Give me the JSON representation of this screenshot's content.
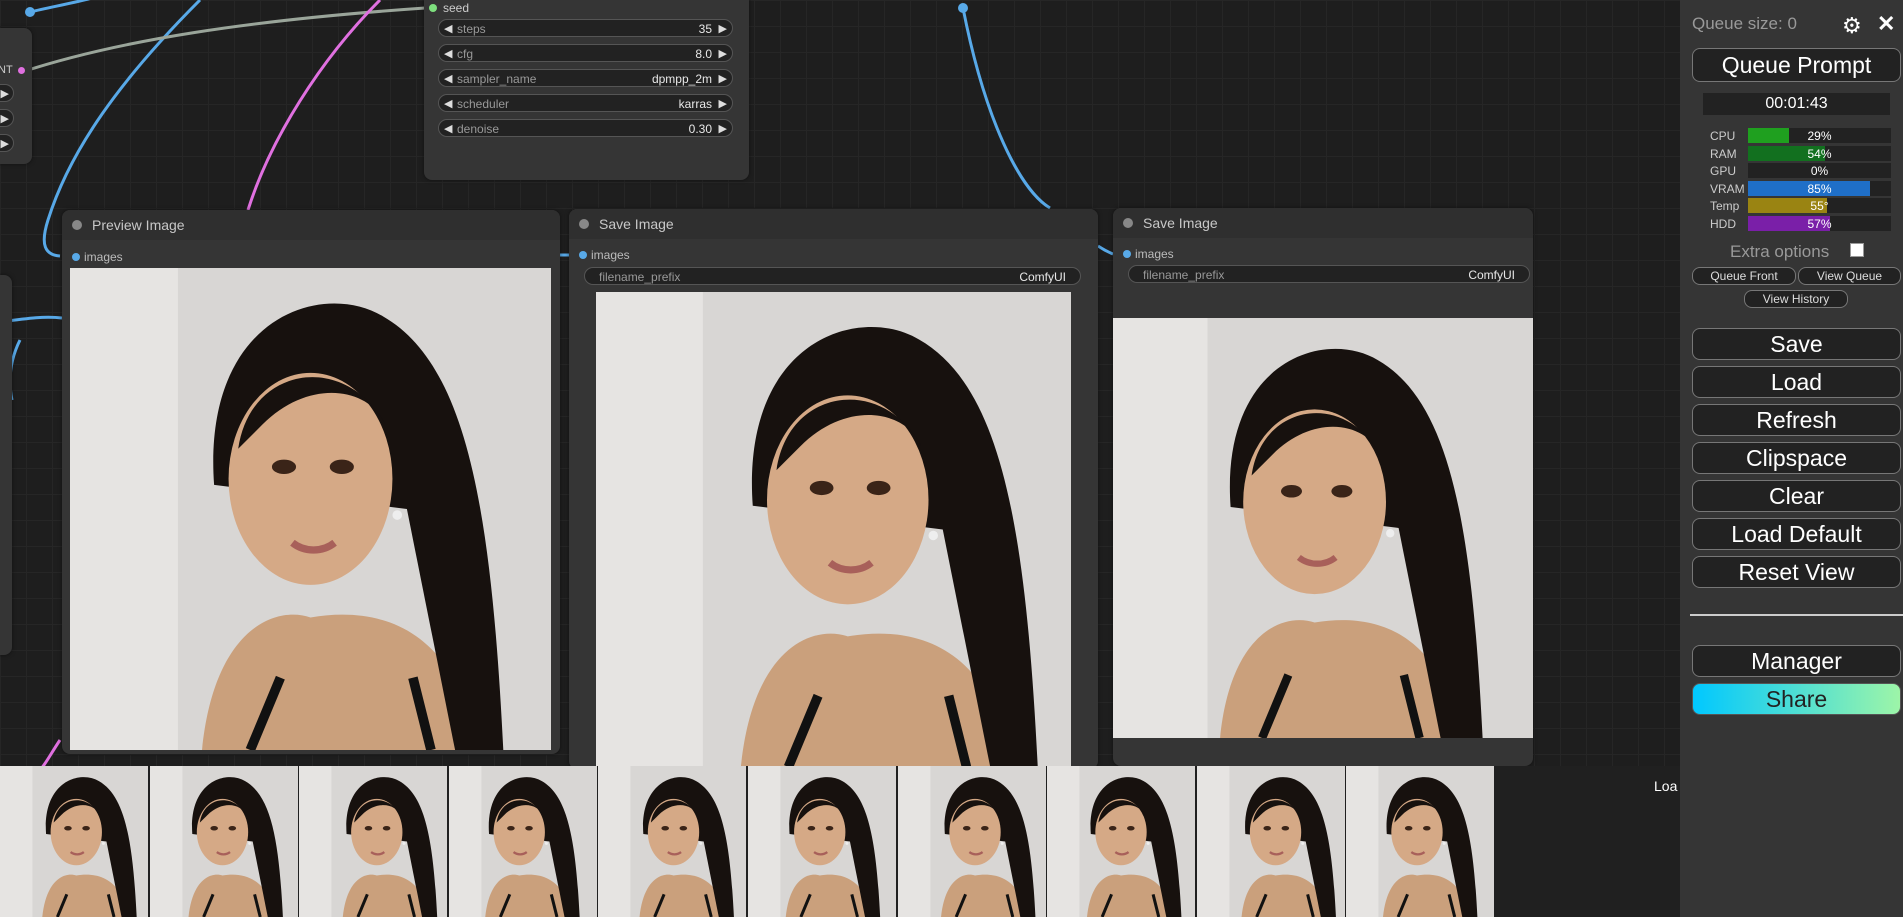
{
  "sampler_node": {
    "seed_label": "seed",
    "widgets": [
      {
        "label": "steps",
        "value": "35"
      },
      {
        "label": "cfg",
        "value": "8.0"
      },
      {
        "label": "sampler_name",
        "value": "dpmpp_2m"
      },
      {
        "label": "scheduler",
        "value": "karras"
      },
      {
        "label": "denoise",
        "value": "0.30"
      }
    ]
  },
  "left_node": {
    "output_label": "NT"
  },
  "preview_node": {
    "title": "Preview Image",
    "input_label": "images"
  },
  "save_node_1": {
    "title": "Save Image",
    "input_label": "images",
    "prefix_label": "filename_prefix",
    "prefix_value": "ComfyUI"
  },
  "save_node_2": {
    "title": "Save Image",
    "input_label": "images",
    "prefix_label": "filename_prefix",
    "prefix_value": "ComfyUI"
  },
  "strip": {
    "label": "Loa",
    "thumbnail_count": 10
  },
  "menu": {
    "queue_size": "Queue size: 0",
    "queue_prompt": "Queue Prompt",
    "timer": "00:01:43",
    "stats": [
      {
        "label": "CPU",
        "value": "29%",
        "fraction": 0.29,
        "color": "#1fa01f"
      },
      {
        "label": "RAM",
        "value": "54%",
        "fraction": 0.54,
        "color": "#12701f"
      },
      {
        "label": "GPU",
        "value": "0%",
        "fraction": 0.0,
        "color": "#1fa01f"
      },
      {
        "label": "VRAM",
        "value": "85%",
        "fraction": 0.85,
        "color": "#1f6fc8"
      },
      {
        "label": "Temp",
        "value": "55°",
        "fraction": 0.55,
        "color": "#9a8412"
      },
      {
        "label": "HDD",
        "value": "57%",
        "fraction": 0.57,
        "color": "#7a1fa8"
      }
    ],
    "extra_options": "Extra options",
    "queue_front": "Queue Front",
    "view_queue": "View Queue",
    "view_history": "View History",
    "buttons": [
      "Save",
      "Load",
      "Refresh",
      "Clipspace",
      "Clear",
      "Load Default",
      "Reset View"
    ],
    "manager": "Manager",
    "share": "Share",
    "gear_icon": "gear-icon",
    "close_icon": "close-icon"
  }
}
